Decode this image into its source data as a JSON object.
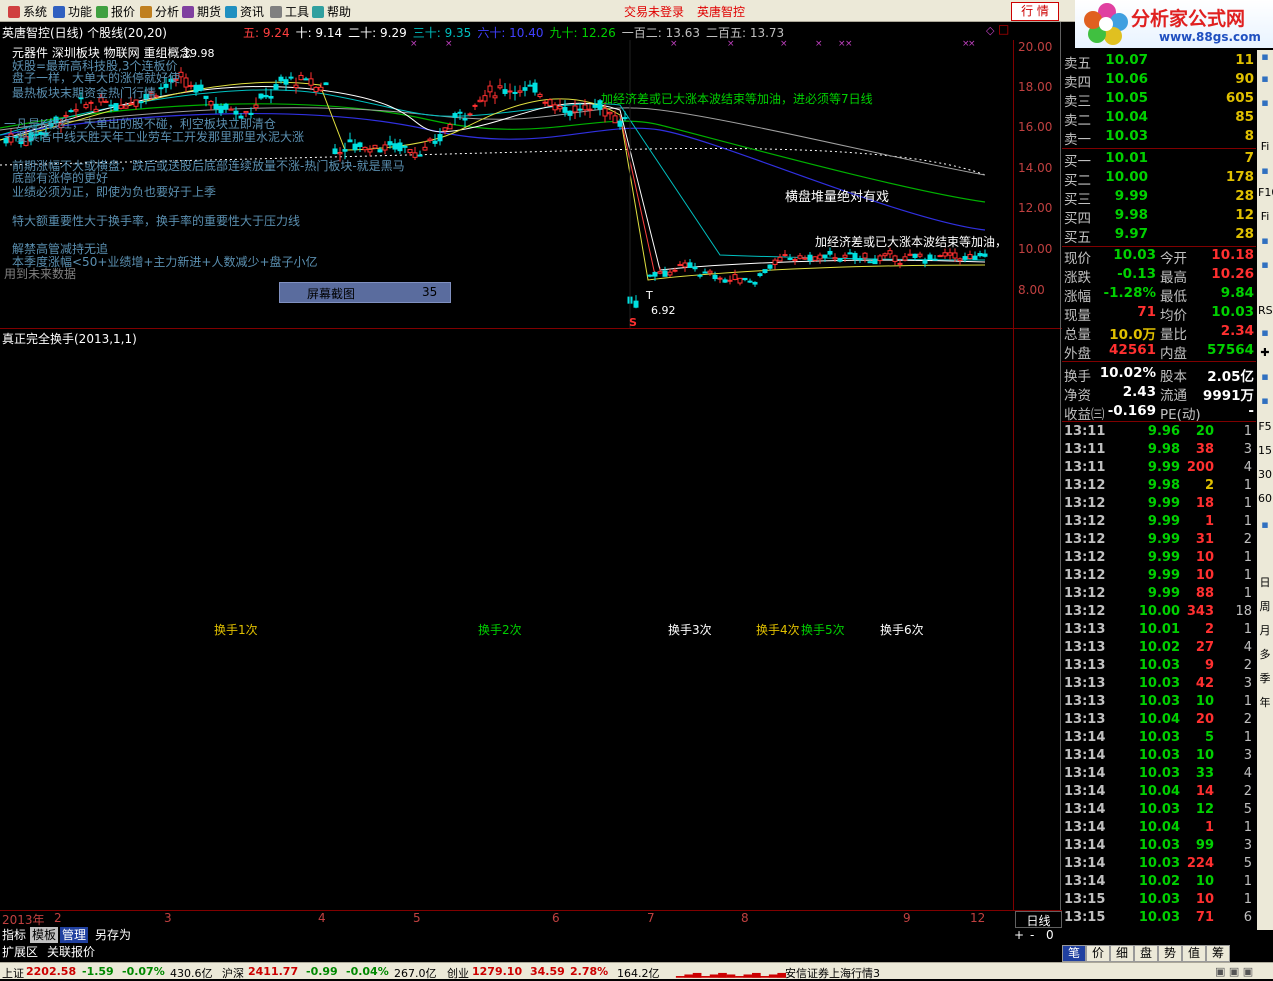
{
  "menu": {
    "items": [
      "系统",
      "功能",
      "报价",
      "分析",
      "期货",
      "资讯",
      "工具",
      "帮助"
    ],
    "login_status": "交易未登录",
    "brand": "英唐智控",
    "quote_button": "行 情"
  },
  "logo": {
    "name": "分析家公式网",
    "url": "www.88gs.com"
  },
  "chart": {
    "title": "英唐智控(日线) 个股线(20,20)",
    "ma": [
      {
        "label": "五:",
        "value": "9.24",
        "color": "#ff4040"
      },
      {
        "label": "十:",
        "value": "9.14",
        "color": "#ffffff"
      },
      {
        "label": "二十:",
        "value": "9.29",
        "color": "#ffffff"
      },
      {
        "label": "三十:",
        "value": "9.35",
        "color": "#00c0c0"
      },
      {
        "label": "六十:",
        "value": "10.40",
        "color": "#4040ff"
      },
      {
        "label": "九十:",
        "value": "12.26",
        "color": "#00d000"
      },
      {
        "label": "一百二:",
        "value": "13.63",
        "color": "#c0c0c0"
      },
      {
        "label": "二百五:",
        "value": "13.73",
        "color": "#c0c0c0"
      }
    ],
    "sector": "元器件 深圳板块 物联网 重组概念",
    "high_mark": "19.98",
    "low_mark": "6.92",
    "y_axis": [
      "20.00",
      "18.00",
      "16.00",
      "14.00",
      "12.00",
      "10.00",
      "8.00"
    ],
    "notes_overlay": [
      {
        "text": "妖股=最新高科技股,3个连板价",
        "color": "#5a8fb0"
      },
      {
        "text": "盘子一样，大单大的涨停就好使",
        "color": "#5a8fb0"
      },
      {
        "text": "最热板块末期资金热门行情",
        "color": "#5a8fb0"
      },
      {
        "text": "一凡是K线红，大单出的股不碰，利空板块立即清仓",
        "color": "#5a8fb0"
      },
      {
        "text": "一要买者中线天胜天年工业劳车工开发那里那里水泥大涨",
        "color": "#5a8fb0"
      },
      {
        "text": "前期涨幅不大或横盘，跌后或送股后底部连续放量不涨-热门板块-就是黑马",
        "color": "#5a8fb0"
      },
      {
        "text": "底部有涨停的更好",
        "color": "#5a8fb0"
      },
      {
        "text": "业绩必须为正，即使为负也要好于上季",
        "color": "#5a8fb0"
      },
      {
        "text": "特大额重要性大于换手率，换手率的重要性大于压力线",
        "color": "#5a8fb0"
      },
      {
        "text": "解禁高管减持无追",
        "color": "#5a8fb0"
      },
      {
        "text": "本季度涨幅<50+业绩增+主力新进+人数减少+盘子小亿",
        "color": "#5a8fb0"
      },
      {
        "text": "用到未来数据",
        "color": "#808080"
      }
    ],
    "annotation1": "加经济差或已大涨本波结束等加油，进必须等7日线",
    "annotation2": "横盘堆量绝对有戏",
    "annotation3": "加经济差或已大涨本波结束等加油，",
    "screenshot_label": "屏幕截图",
    "screenshot_num": "35",
    "sell_mark": "S",
    "buy_mark": "T"
  },
  "indicator": {
    "title": "真正完全换手(2013,1,1)",
    "labels": [
      {
        "text": "换手1次",
        "color": "#e0c000"
      },
      {
        "text": "换手2次",
        "color": "#00d000"
      },
      {
        "text": "换手3次",
        "color": "#ffffff"
      },
      {
        "text": "换手4次",
        "color": "#e0c000"
      },
      {
        "text": "换手5次",
        "color": "#00d000"
      },
      {
        "text": "换手6次",
        "color": "#ffffff"
      }
    ]
  },
  "date_axis": {
    "year": "2013年",
    "months": [
      "2",
      "3",
      "4",
      "5",
      "6",
      "7",
      "8",
      "9",
      "12"
    ],
    "period": "日线"
  },
  "bottom_tabs": [
    "指标",
    "模板",
    "管理",
    "另存为"
  ],
  "bottom_sub": [
    "扩展区",
    "关联报价"
  ],
  "zoom_controls": [
    "+",
    "-",
    "0"
  ],
  "orderbook": {
    "sells": [
      {
        "label": "卖五",
        "price": "10.07",
        "vol": "11"
      },
      {
        "label": "卖四",
        "price": "10.06",
        "vol": "90"
      },
      {
        "label": "卖三",
        "price": "10.05",
        "vol": "605"
      },
      {
        "label": "卖二",
        "price": "10.04",
        "vol": "85"
      },
      {
        "label": "卖一",
        "price": "10.03",
        "vol": "8"
      }
    ],
    "buys": [
      {
        "label": "买一",
        "price": "10.01",
        "vol": "7"
      },
      {
        "label": "买二",
        "price": "10.00",
        "vol": "178"
      },
      {
        "label": "买三",
        "price": "9.99",
        "vol": "28"
      },
      {
        "label": "买四",
        "price": "9.98",
        "vol": "12"
      },
      {
        "label": "买五",
        "price": "9.97",
        "vol": "28"
      }
    ]
  },
  "quote": [
    {
      "l1": "现价",
      "v1": "10.03",
      "c1": "#00d000",
      "l2": "今开",
      "v2": "10.18",
      "c2": "#ff3030"
    },
    {
      "l1": "涨跌",
      "v1": "-0.13",
      "c1": "#00d000",
      "l2": "最高",
      "v2": "10.26",
      "c2": "#ff3030"
    },
    {
      "l1": "涨幅",
      "v1": "-1.28%",
      "c1": "#00d000",
      "l2": "最低",
      "v2": "9.84",
      "c2": "#00d000"
    },
    {
      "l1": "现量",
      "v1": "71",
      "c1": "#ff3030",
      "l2": "均价",
      "v2": "10.03",
      "c2": "#00d000"
    },
    {
      "l1": "总量",
      "v1": "10.0万",
      "c1": "#e0c000",
      "l2": "量比",
      "v2": "2.34",
      "c2": "#ff3030"
    },
    {
      "l1": "外盘",
      "v1": "42561",
      "c1": "#ff3030",
      "l2": "内盘",
      "v2": "57564",
      "c2": "#00d000"
    },
    {
      "l1": "换手",
      "v1": "10.02%",
      "c1": "#ffffff",
      "l2": "股本",
      "v2": "2.05亿",
      "c2": "#ffffff"
    },
    {
      "l1": "净资",
      "v1": "2.43",
      "c1": "#ffffff",
      "l2": "流通",
      "v2": "9991万",
      "c2": "#ffffff"
    },
    {
      "l1": "收益㈢",
      "v1": "-0.169",
      "c1": "#ffffff",
      "l2": "PE(动)",
      "v2": "-",
      "c2": "#ffffff"
    }
  ],
  "ticks": [
    {
      "t": "13:11",
      "p": "9.96",
      "pc": "#00d000",
      "v": "20",
      "vc": "#00d000",
      "n": "1"
    },
    {
      "t": "13:11",
      "p": "9.98",
      "pc": "#00d000",
      "v": "38",
      "vc": "#ff3030",
      "n": "3"
    },
    {
      "t": "13:11",
      "p": "9.99",
      "pc": "#00d000",
      "v": "200",
      "vc": "#ff3030",
      "n": "4"
    },
    {
      "t": "13:12",
      "p": "9.98",
      "pc": "#00d000",
      "v": "2",
      "vc": "#e0c000",
      "n": "1"
    },
    {
      "t": "13:12",
      "p": "9.99",
      "pc": "#00d000",
      "v": "18",
      "vc": "#ff3030",
      "n": "1"
    },
    {
      "t": "13:12",
      "p": "9.99",
      "pc": "#00d000",
      "v": "1",
      "vc": "#ff3030",
      "n": "1"
    },
    {
      "t": "13:12",
      "p": "9.99",
      "pc": "#00d000",
      "v": "31",
      "vc": "#ff3030",
      "n": "2"
    },
    {
      "t": "13:12",
      "p": "9.99",
      "pc": "#00d000",
      "v": "10",
      "vc": "#ff3030",
      "n": "1"
    },
    {
      "t": "13:12",
      "p": "9.99",
      "pc": "#00d000",
      "v": "10",
      "vc": "#ff3030",
      "n": "1"
    },
    {
      "t": "13:12",
      "p": "9.99",
      "pc": "#00d000",
      "v": "88",
      "vc": "#ff3030",
      "n": "1"
    },
    {
      "t": "13:12",
      "p": "10.00",
      "pc": "#00d000",
      "v": "343",
      "vc": "#ff3030",
      "n": "18"
    },
    {
      "t": "13:13",
      "p": "10.01",
      "pc": "#00d000",
      "v": "2",
      "vc": "#ff3030",
      "n": "1"
    },
    {
      "t": "13:13",
      "p": "10.02",
      "pc": "#00d000",
      "v": "27",
      "vc": "#ff3030",
      "n": "4"
    },
    {
      "t": "13:13",
      "p": "10.03",
      "pc": "#00d000",
      "v": "9",
      "vc": "#ff3030",
      "n": "2"
    },
    {
      "t": "13:13",
      "p": "10.03",
      "pc": "#00d000",
      "v": "42",
      "vc": "#ff3030",
      "n": "3"
    },
    {
      "t": "13:13",
      "p": "10.03",
      "pc": "#00d000",
      "v": "10",
      "vc": "#00d000",
      "n": "1"
    },
    {
      "t": "13:13",
      "p": "10.04",
      "pc": "#00d000",
      "v": "20",
      "vc": "#ff3030",
      "n": "2"
    },
    {
      "t": "13:14",
      "p": "10.03",
      "pc": "#00d000",
      "v": "5",
      "vc": "#00d000",
      "n": "1"
    },
    {
      "t": "13:14",
      "p": "10.03",
      "pc": "#00d000",
      "v": "10",
      "vc": "#00d000",
      "n": "3"
    },
    {
      "t": "13:14",
      "p": "10.03",
      "pc": "#00d000",
      "v": "33",
      "vc": "#00d000",
      "n": "4"
    },
    {
      "t": "13:14",
      "p": "10.04",
      "pc": "#00d000",
      "v": "14",
      "vc": "#ff3030",
      "n": "2"
    },
    {
      "t": "13:14",
      "p": "10.03",
      "pc": "#00d000",
      "v": "12",
      "vc": "#00d000",
      "n": "5"
    },
    {
      "t": "13:14",
      "p": "10.04",
      "pc": "#00d000",
      "v": "1",
      "vc": "#ff3030",
      "n": "1"
    },
    {
      "t": "13:14",
      "p": "10.03",
      "pc": "#00d000",
      "v": "99",
      "vc": "#00d000",
      "n": "3"
    },
    {
      "t": "13:14",
      "p": "10.03",
      "pc": "#00d000",
      "v": "224",
      "vc": "#ff3030",
      "n": "5"
    },
    {
      "t": "13:14",
      "p": "10.02",
      "pc": "#00d000",
      "v": "10",
      "vc": "#00d000",
      "n": "1"
    },
    {
      "t": "13:15",
      "p": "10.03",
      "pc": "#00d000",
      "v": "10",
      "vc": "#ff3030",
      "n": "1"
    },
    {
      "t": "13:15",
      "p": "10.03",
      "pc": "#00d000",
      "v": "71",
      "vc": "#ff3030",
      "n": "6"
    }
  ],
  "right_tabs": [
    "笔",
    "价",
    "细",
    "盘",
    "势",
    "值",
    "筹"
  ],
  "sidebar_labels": [
    "Fi",
    "F10",
    "RSI",
    "F5",
    "15",
    "30",
    "60",
    "日",
    "周",
    "月",
    "多",
    "季",
    "年"
  ],
  "statusbar": {
    "sh_label": "上证",
    "sh_val": "2202.58",
    "sh_chg": "-1.59",
    "sh_pct": "-0.07%",
    "sh_amt": "430.6亿",
    "sz_label": "沪深",
    "sz_val": "2411.77",
    "sz_chg": "-0.99",
    "sz_pct": "-0.04%",
    "sz_amt": "267.0亿",
    "cy_label": "创业",
    "cy_val": "1279.10",
    "cy_chg": "34.59",
    "cy_pct": "2.78%",
    "cy_amt": "164.2亿",
    "broker": "安信证券上海行情3"
  }
}
